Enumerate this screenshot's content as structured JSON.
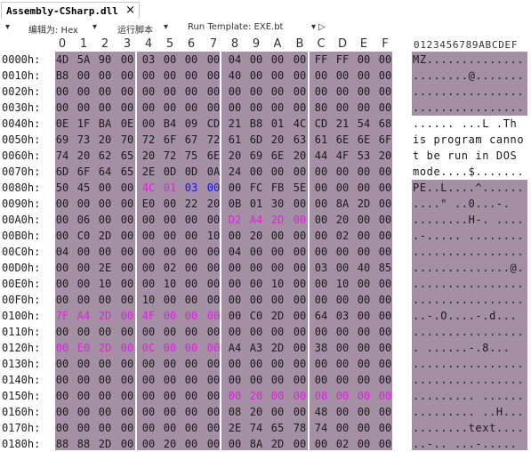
{
  "tab": {
    "label": "Assembly-CSharp.dll",
    "close_label": "×"
  },
  "toolbar": {
    "collapse_icon": "▾",
    "edit_as_label": "编辑为: Hex",
    "edit_as_arrow": "▾",
    "run_script_label": "运行脚本",
    "run_script_arrow": "▾",
    "run_template_label": "Run Template: EXE.bt",
    "run_template_arrow": "▾",
    "play_icon": "▷"
  },
  "column_headers": [
    "0",
    "1",
    "2",
    "3",
    "4",
    "5",
    "6",
    "7",
    "8",
    "9",
    "A",
    "B",
    "C",
    "D",
    "E",
    "F"
  ],
  "ascii_header": "0123456789ABCDEF",
  "rows": [
    {
      "offset": "0000h:",
      "bytes": [
        "4D",
        "5A",
        "90",
        "00",
        "03",
        "00",
        "00",
        "00",
        "04",
        "00",
        "00",
        "00",
        "FF",
        "FF",
        "00",
        "00"
      ],
      "ascii": "MZ..............",
      "ascii_white": false
    },
    {
      "offset": "0010h:",
      "bytes": [
        "B8",
        "00",
        "00",
        "00",
        "00",
        "00",
        "00",
        "00",
        "40",
        "00",
        "00",
        "00",
        "00",
        "00",
        "00",
        "00"
      ],
      "ascii": "........@.......",
      "ascii_white": false
    },
    {
      "offset": "0020h:",
      "bytes": [
        "00",
        "00",
        "00",
        "00",
        "00",
        "00",
        "00",
        "00",
        "00",
        "00",
        "00",
        "00",
        "00",
        "00",
        "00",
        "00"
      ],
      "ascii": "................",
      "ascii_white": false
    },
    {
      "offset": "0030h:",
      "bytes": [
        "00",
        "00",
        "00",
        "00",
        "00",
        "00",
        "00",
        "00",
        "00",
        "00",
        "00",
        "00",
        "80",
        "00",
        "00",
        "00"
      ],
      "ascii": "................",
      "ascii_white": false
    },
    {
      "offset": "0040h:",
      "bytes": [
        "0E",
        "1F",
        "BA",
        "0E",
        "00",
        "B4",
        "09",
        "CD",
        "21",
        "B8",
        "01",
        "4C",
        "CD",
        "21",
        "54",
        "68"
      ],
      "ascii": "...... ...L .Th",
      "ascii_white": true
    },
    {
      "offset": "0050h:",
      "bytes": [
        "69",
        "73",
        "20",
        "70",
        "72",
        "6F",
        "67",
        "72",
        "61",
        "6D",
        "20",
        "63",
        "61",
        "6E",
        "6E",
        "6F"
      ],
      "ascii": "is program canno",
      "ascii_white": true
    },
    {
      "offset": "0060h:",
      "bytes": [
        "74",
        "20",
        "62",
        "65",
        "20",
        "72",
        "75",
        "6E",
        "20",
        "69",
        "6E",
        "20",
        "44",
        "4F",
        "53",
        "20"
      ],
      "ascii": "t be run in DOS ",
      "ascii_white": true
    },
    {
      "offset": "0070h:",
      "bytes": [
        "6D",
        "6F",
        "64",
        "65",
        "2E",
        "0D",
        "0D",
        "0A",
        "24",
        "00",
        "00",
        "00",
        "00",
        "00",
        "00",
        "00"
      ],
      "ascii": "mode....$.......",
      "ascii_white": true
    },
    {
      "offset": "0080h:",
      "bytes": [
        "50",
        "45",
        "00",
        "00",
        "4C",
        "01",
        "03",
        "00",
        "00",
        "FC",
        "FB",
        "5E",
        "00",
        "00",
        "00",
        "00"
      ],
      "ascii": "PE..L....^......",
      "ascii_white": false,
      "colors": {
        "4": "mag",
        "5": "mag",
        "6": "blu",
        "7": "blu"
      }
    },
    {
      "offset": "0090h:",
      "bytes": [
        "00",
        "00",
        "00",
        "00",
        "E0",
        "00",
        "22",
        "20",
        "0B",
        "01",
        "30",
        "00",
        "00",
        "8A",
        "2D",
        "00"
      ],
      "ascii": "....\" ..0...-.",
      "ascii_white": false
    },
    {
      "offset": "00A0h:",
      "bytes": [
        "00",
        "06",
        "00",
        "00",
        "00",
        "00",
        "00",
        "00",
        "D2",
        "A4",
        "2D",
        "00",
        "00",
        "20",
        "00",
        "00"
      ],
      "ascii": "........H-. ....",
      "ascii_white": false,
      "colors": {
        "8": "mag",
        "9": "mag",
        "10": "mag",
        "11": "mag"
      }
    },
    {
      "offset": "00B0h:",
      "bytes": [
        "00",
        "C0",
        "2D",
        "00",
        "00",
        "00",
        "00",
        "10",
        "00",
        "20",
        "00",
        "00",
        "00",
        "02",
        "00",
        "00"
      ],
      "ascii": ".-..... ........",
      "ascii_white": false
    },
    {
      "offset": "00C0h:",
      "bytes": [
        "04",
        "00",
        "00",
        "00",
        "00",
        "00",
        "00",
        "00",
        "04",
        "00",
        "00",
        "00",
        "00",
        "00",
        "00",
        "00"
      ],
      "ascii": "................",
      "ascii_white": false
    },
    {
      "offset": "00D0h:",
      "bytes": [
        "00",
        "00",
        "2E",
        "00",
        "00",
        "02",
        "00",
        "00",
        "00",
        "00",
        "00",
        "00",
        "03",
        "00",
        "40",
        "85"
      ],
      "ascii": "..............@.",
      "ascii_white": false
    },
    {
      "offset": "00E0h:",
      "bytes": [
        "00",
        "00",
        "10",
        "00",
        "00",
        "10",
        "00",
        "00",
        "00",
        "00",
        "10",
        "00",
        "00",
        "10",
        "00",
        "00"
      ],
      "ascii": "................",
      "ascii_white": false
    },
    {
      "offset": "00F0h:",
      "bytes": [
        "00",
        "00",
        "00",
        "00",
        "10",
        "00",
        "00",
        "00",
        "00",
        "00",
        "00",
        "00",
        "00",
        "00",
        "00",
        "00"
      ],
      "ascii": "................",
      "ascii_white": false
    },
    {
      "offset": "0100h:",
      "bytes": [
        "7F",
        "A4",
        "2D",
        "00",
        "4F",
        "00",
        "00",
        "00",
        "00",
        "C0",
        "2D",
        "00",
        "64",
        "03",
        "00",
        "00"
      ],
      "ascii": "..-.O....-.d...",
      "ascii_white": false,
      "colors": {
        "0": "mag",
        "1": "mag",
        "2": "mag",
        "3": "mag",
        "4": "mag",
        "5": "mag",
        "6": "mag",
        "7": "mag"
      }
    },
    {
      "offset": "0110h:",
      "bytes": [
        "00",
        "00",
        "00",
        "00",
        "00",
        "00",
        "00",
        "00",
        "00",
        "00",
        "00",
        "00",
        "00",
        "00",
        "00",
        "00"
      ],
      "ascii": "................",
      "ascii_white": false
    },
    {
      "offset": "0120h:",
      "bytes": [
        "00",
        "E0",
        "2D",
        "00",
        "0C",
        "00",
        "00",
        "00",
        "A4",
        "A3",
        "2D",
        "00",
        "38",
        "00",
        "00",
        "00"
      ],
      "ascii": ". ......-.8...",
      "ascii_white": false,
      "colors": {
        "0": "mag",
        "1": "mag",
        "2": "mag",
        "3": "mag",
        "4": "mag",
        "5": "mag",
        "6": "mag",
        "7": "mag"
      }
    },
    {
      "offset": "0130h:",
      "bytes": [
        "00",
        "00",
        "00",
        "00",
        "00",
        "00",
        "00",
        "00",
        "00",
        "00",
        "00",
        "00",
        "00",
        "00",
        "00",
        "00"
      ],
      "ascii": "................",
      "ascii_white": false
    },
    {
      "offset": "0140h:",
      "bytes": [
        "00",
        "00",
        "00",
        "00",
        "00",
        "00",
        "00",
        "00",
        "00",
        "00",
        "00",
        "00",
        "00",
        "00",
        "00",
        "00"
      ],
      "ascii": "................",
      "ascii_white": false
    },
    {
      "offset": "0150h:",
      "bytes": [
        "00",
        "00",
        "00",
        "00",
        "00",
        "00",
        "00",
        "00",
        "00",
        "20",
        "00",
        "00",
        "08",
        "00",
        "00",
        "00"
      ],
      "ascii": "......... ......",
      "ascii_white": false,
      "colors": {
        "8": "mag",
        "9": "mag",
        "10": "mag",
        "11": "mag",
        "12": "mag",
        "13": "mag",
        "14": "mag",
        "15": "mag"
      }
    },
    {
      "offset": "0160h:",
      "bytes": [
        "00",
        "00",
        "00",
        "00",
        "00",
        "00",
        "00",
        "00",
        "08",
        "20",
        "00",
        "00",
        "48",
        "00",
        "00",
        "00"
      ],
      "ascii": "......... ..H...",
      "ascii_white": false
    },
    {
      "offset": "0170h:",
      "bytes": [
        "00",
        "00",
        "00",
        "00",
        "00",
        "00",
        "00",
        "00",
        "2E",
        "74",
        "65",
        "78",
        "74",
        "00",
        "00",
        "00"
      ],
      "ascii": "........text....",
      "ascii_white": false
    },
    {
      "offset": "0180h:",
      "bytes": [
        "88",
        "88",
        "2D",
        "00",
        "00",
        "20",
        "00",
        "00",
        "00",
        "8A",
        "2D",
        "00",
        "00",
        "02",
        "00",
        "00"
      ],
      "ascii": "..-.. ...-.....",
      "ascii_white": false
    }
  ]
}
